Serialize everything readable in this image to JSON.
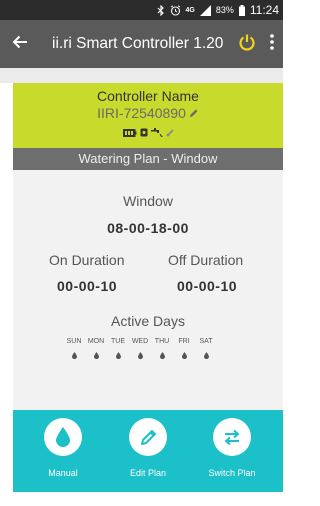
{
  "status_bar": {
    "network": "4G",
    "battery_percent": "83%",
    "time": "11:24"
  },
  "app_bar": {
    "title": "ii.ri Smart Controller 1.20",
    "icons": [
      "back-arrow-icon",
      "power-icon",
      "more-vert-icon"
    ],
    "power_color": "#f3d21b"
  },
  "controller": {
    "label": "Controller Name",
    "id": "IIRI-72540890"
  },
  "plan": {
    "bar_title": "Watering Plan - Window",
    "window_label": "Window",
    "window_value": "08-00-18-00",
    "on_label": "On Duration",
    "on_value": "00-00-10",
    "off_label": "Off Duration",
    "off_value": "00-00-10",
    "active_days_label": "Active Days",
    "days": [
      "SUN",
      "MON",
      "TUE",
      "WED",
      "THU",
      "FRI",
      "SAT"
    ]
  },
  "actions": [
    {
      "label": "Manual",
      "icon": "water-drop-icon"
    },
    {
      "label": "Edit Plan",
      "icon": "pencil-icon"
    },
    {
      "label": "Switch Plan",
      "icon": "swap-arrows-icon"
    }
  ],
  "colors": {
    "accent_lime": "#c8da2b",
    "action_teal": "#1cc0c8",
    "app_bar": "#5a5a5a",
    "plan_bar": "#6e6e6e"
  }
}
